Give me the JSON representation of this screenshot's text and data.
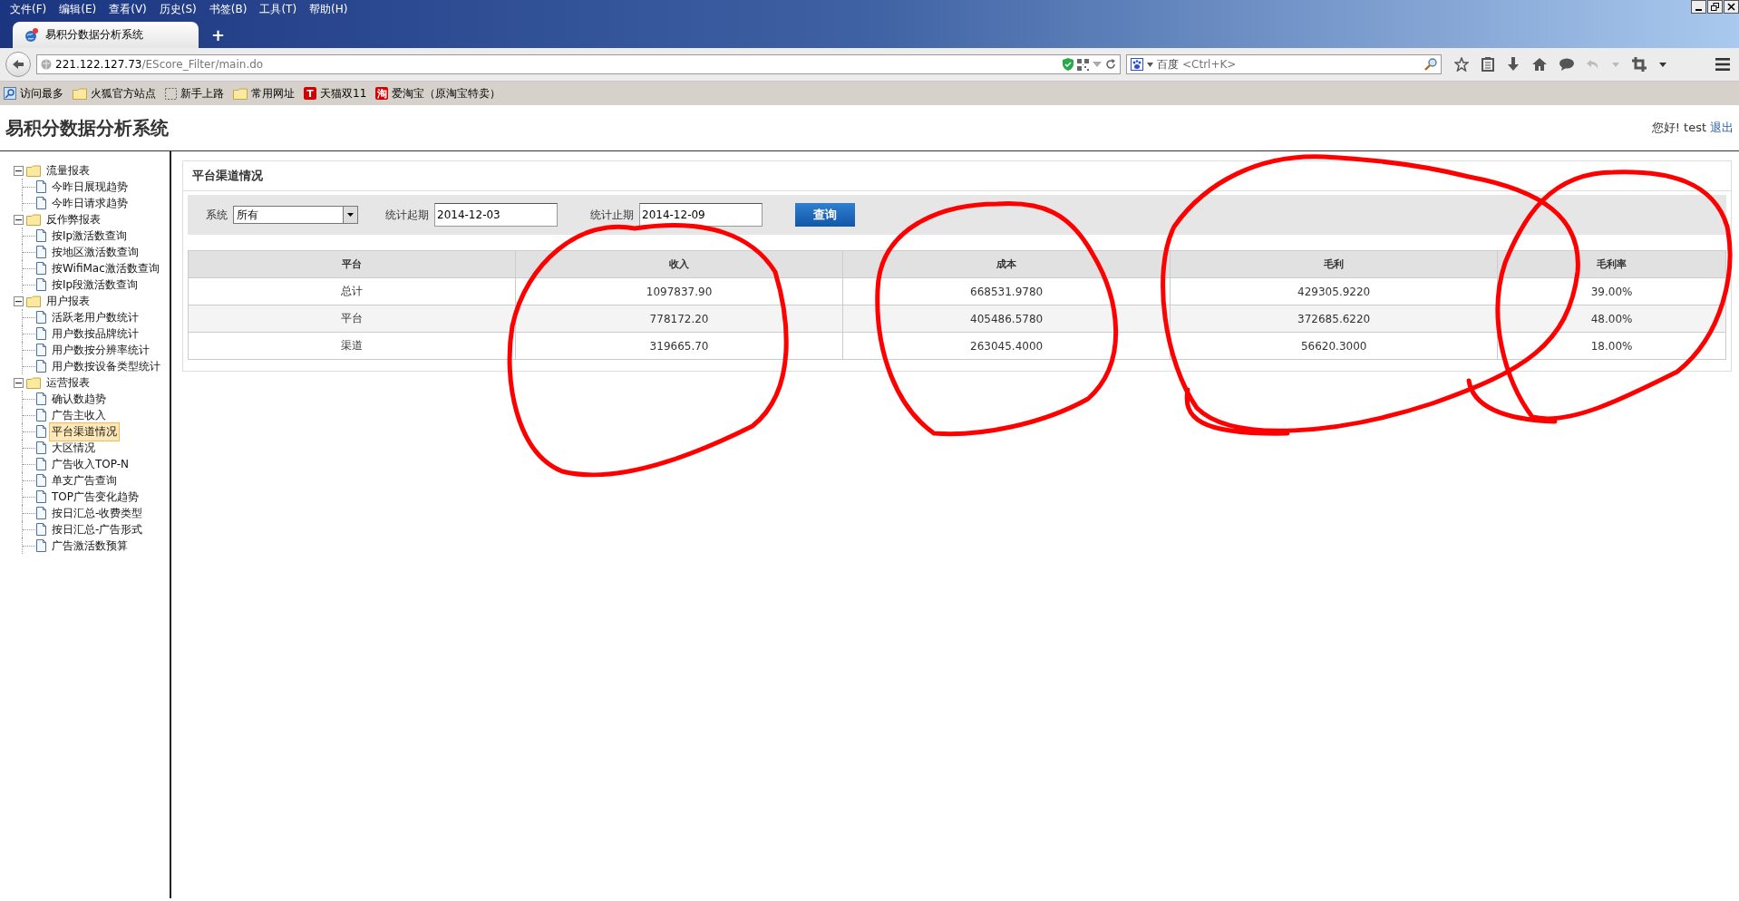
{
  "browser": {
    "menu": [
      "文件(F)",
      "编辑(E)",
      "查看(V)",
      "历史(S)",
      "书签(B)",
      "工具(T)",
      "帮助(H)"
    ],
    "tab": {
      "title": "易积分数据分析系统",
      "selected": true
    },
    "new_tab": "+",
    "address": {
      "host": "221.122.127.73",
      "path": "/EScore_Filter/main.do"
    },
    "search": {
      "engine": "百度",
      "placeholder": "<Ctrl+K>"
    },
    "bookmarks": [
      {
        "label": "访问最多",
        "kind": "smart"
      },
      {
        "label": "火狐官方站点",
        "kind": "folder"
      },
      {
        "label": "新手上路",
        "kind": "page"
      },
      {
        "label": "常用网址",
        "kind": "folder"
      },
      {
        "label": "天猫双11",
        "kind": "badge",
        "badge": "T"
      },
      {
        "label": "爱淘宝（原淘宝特卖）",
        "kind": "badge",
        "badge": "淘"
      }
    ]
  },
  "header": {
    "title": "易积分数据分析系统",
    "greeting": "您好! test",
    "logout": "退出"
  },
  "sidebar": {
    "tree": [
      {
        "label": "流量报表",
        "expanded": true,
        "children": [
          {
            "label": "今昨日展现趋势",
            "selected": false
          },
          {
            "label": "今昨日请求趋势",
            "selected": false
          }
        ]
      },
      {
        "label": "反作弊报表",
        "expanded": true,
        "children": [
          {
            "label": "按Ip激活数查询",
            "selected": false
          },
          {
            "label": "按地区激活数查询",
            "selected": false
          },
          {
            "label": "按WifiMac激活数查询",
            "selected": false
          },
          {
            "label": "按Ip段激活数查询",
            "selected": false
          }
        ]
      },
      {
        "label": "用户报表",
        "expanded": true,
        "children": [
          {
            "label": "活跃老用户数统计",
            "selected": false
          },
          {
            "label": "用户数按品牌统计",
            "selected": false
          },
          {
            "label": "用户数按分辨率统计",
            "selected": false
          },
          {
            "label": "用户数按设备类型统计",
            "selected": false
          }
        ]
      },
      {
        "label": "运营报表",
        "expanded": true,
        "children": [
          {
            "label": "确认数趋势",
            "selected": false
          },
          {
            "label": "广告主收入",
            "selected": false
          },
          {
            "label": "平台渠道情况",
            "selected": true
          },
          {
            "label": "大区情况",
            "selected": false
          },
          {
            "label": "广告收入TOP-N",
            "selected": false
          },
          {
            "label": "单支广告查询",
            "selected": false
          },
          {
            "label": "TOP广告变化趋势",
            "selected": false
          },
          {
            "label": "按日汇总-收费类型",
            "selected": false
          },
          {
            "label": "按日汇总-广告形式",
            "selected": false
          },
          {
            "label": "广告激活数预算",
            "selected": false
          }
        ]
      }
    ]
  },
  "panel": {
    "title": "平台渠道情况",
    "filters": {
      "system_label": "系统",
      "system_value": "所有",
      "start_label": "统计起期",
      "start_value": "2014-12-03",
      "end_label": "统计止期",
      "end_value": "2014-12-09",
      "query_button": "查询"
    },
    "table": {
      "columns": [
        "平台",
        "收入",
        "成本",
        "毛利",
        "毛利率"
      ],
      "rows": [
        [
          "总计",
          "1097837.90",
          "668531.9780",
          "429305.9220",
          "39.00%"
        ],
        [
          "平台",
          "778172.20",
          "405486.5780",
          "372685.6220",
          "48.00%"
        ],
        [
          "渠道",
          "319665.70",
          "263045.4000",
          "56620.3000",
          "18.00%"
        ]
      ]
    }
  }
}
